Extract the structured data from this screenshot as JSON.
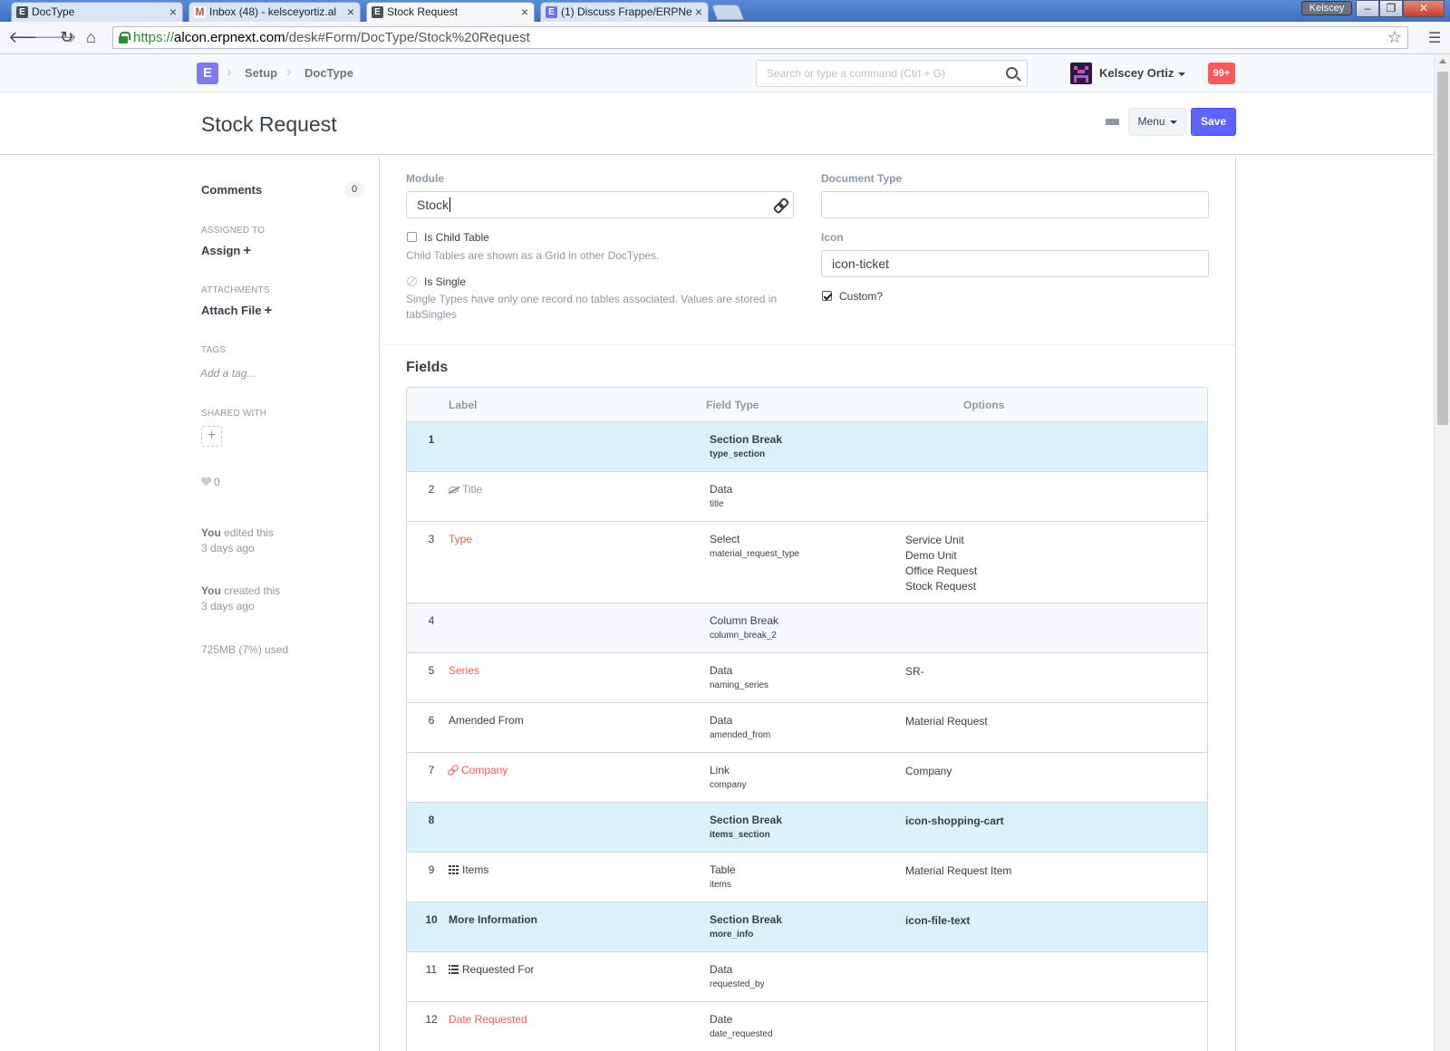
{
  "browser": {
    "tabs": [
      {
        "title": "DocType",
        "favicon": "E",
        "active": false
      },
      {
        "title": "Inbox (48) - kelsceyortiz.al",
        "favicon": "M",
        "active": false
      },
      {
        "title": "Stock Request",
        "favicon": "E",
        "active": true
      },
      {
        "title": "(1) Discuss Frappe/ERPNe",
        "favicon": "E",
        "active": false
      }
    ],
    "profile_name": "Kelscey",
    "url_scheme": "https://",
    "url_host": "alcon.erpnext.com",
    "url_path": "/desk#Form/DocType/Stock%20Request",
    "icons": [
      "back-icon",
      "forward-icon",
      "reload-icon",
      "home-icon",
      "lock-icon",
      "star-icon",
      "menu-icon"
    ]
  },
  "navbar": {
    "logo": "E",
    "breadcrumbs": [
      "Setup",
      "DocType"
    ],
    "search_placeholder": "Search or type a command (Ctrl + G)",
    "user_name": "Kelscey Ortiz",
    "notification_count": "99+",
    "brand_color": "#5e64ff",
    "alert_color": "#ff5858"
  },
  "page": {
    "title": "Stock Request",
    "menu_label": "Menu",
    "save_label": "Save"
  },
  "sidebar": {
    "comments_label": "Comments",
    "comments_count": "0",
    "assigned_to_label": "ASSIGNED TO",
    "assign_label": "Assign",
    "attachments_label": "ATTACHMENTS",
    "attach_file_label": "Attach File",
    "tags_label": "TAGS",
    "add_tag_placeholder": "Add a tag...",
    "shared_with_label": "SHARED WITH",
    "likes_count": "0",
    "activity": [
      {
        "who": "You",
        "action": "edited this",
        "when": "3 days ago"
      },
      {
        "who": "You",
        "action": "created this",
        "when": "3 days ago"
      }
    ],
    "storage_used": "725MB (7%) used"
  },
  "form": {
    "module_label": "Module",
    "module_value": "Stock",
    "document_type_label": "Document Type",
    "document_type_value": "",
    "is_child_table_label": "Is Child Table",
    "is_child_table_checked": false,
    "is_child_table_help": "Child Tables are shown as a Grid in other DocTypes.",
    "is_single_label": "Is Single",
    "is_single_checked": false,
    "is_single_help_1": "Single Types have only one record no tables associated. Values are stored in",
    "is_single_help_2": "tabSingles",
    "icon_label": "Icon",
    "icon_value": "icon-ticket",
    "custom_label": "Custom?",
    "custom_checked": true
  },
  "fields_section": {
    "title": "Fields",
    "columns": [
      "Label",
      "Field Type",
      "Options"
    ],
    "rows": [
      {
        "idx": "1",
        "label": "",
        "type": "Section Break",
        "fieldname": "type_section",
        "options": "",
        "kind": "section",
        "icon": "",
        "style": ""
      },
      {
        "idx": "2",
        "label": "Title",
        "type": "Data",
        "fieldname": "title",
        "options": "",
        "kind": "normal",
        "icon": "eye-slash-icon",
        "style": "muted"
      },
      {
        "idx": "3",
        "label": "Type",
        "type": "Select",
        "fieldname": "material_request_type",
        "options": "Service Unit\nDemo Unit\nOffice Request\nStock Request",
        "kind": "normal",
        "icon": "",
        "style": "req"
      },
      {
        "idx": "4",
        "label": "",
        "type": "Column Break",
        "fieldname": "column_break_2",
        "options": "",
        "kind": "column",
        "icon": "",
        "style": ""
      },
      {
        "idx": "5",
        "label": "Series",
        "type": "Data",
        "fieldname": "naming_series",
        "options": "SR-",
        "kind": "normal",
        "icon": "",
        "style": "req"
      },
      {
        "idx": "6",
        "label": "Amended From",
        "type": "Data",
        "fieldname": "amended_from",
        "options": "Material Request",
        "kind": "normal",
        "icon": "",
        "style": ""
      },
      {
        "idx": "7",
        "label": "Company",
        "type": "Link",
        "fieldname": "company",
        "options": "Company",
        "kind": "normal",
        "icon": "link-icon",
        "style": "req"
      },
      {
        "idx": "8",
        "label": "",
        "type": "Section Break",
        "fieldname": "items_section",
        "options": "icon-shopping-cart",
        "kind": "section",
        "icon": "",
        "style": ""
      },
      {
        "idx": "9",
        "label": "Items",
        "type": "Table",
        "fieldname": "items",
        "options": "Material Request Item",
        "kind": "normal",
        "icon": "table-icon",
        "style": ""
      },
      {
        "idx": "10",
        "label": "More Information",
        "type": "Section Break",
        "fieldname": "more_info",
        "options": "icon-file-text",
        "kind": "section",
        "icon": "",
        "style": ""
      },
      {
        "idx": "11",
        "label": "Requested For",
        "type": "Data",
        "fieldname": "requested_by",
        "options": "",
        "kind": "normal",
        "icon": "list-icon",
        "style": ""
      },
      {
        "idx": "12",
        "label": "Date Requested",
        "type": "Date",
        "fieldname": "date_requested",
        "options": "",
        "kind": "normal",
        "icon": "",
        "style": "req"
      }
    ]
  }
}
